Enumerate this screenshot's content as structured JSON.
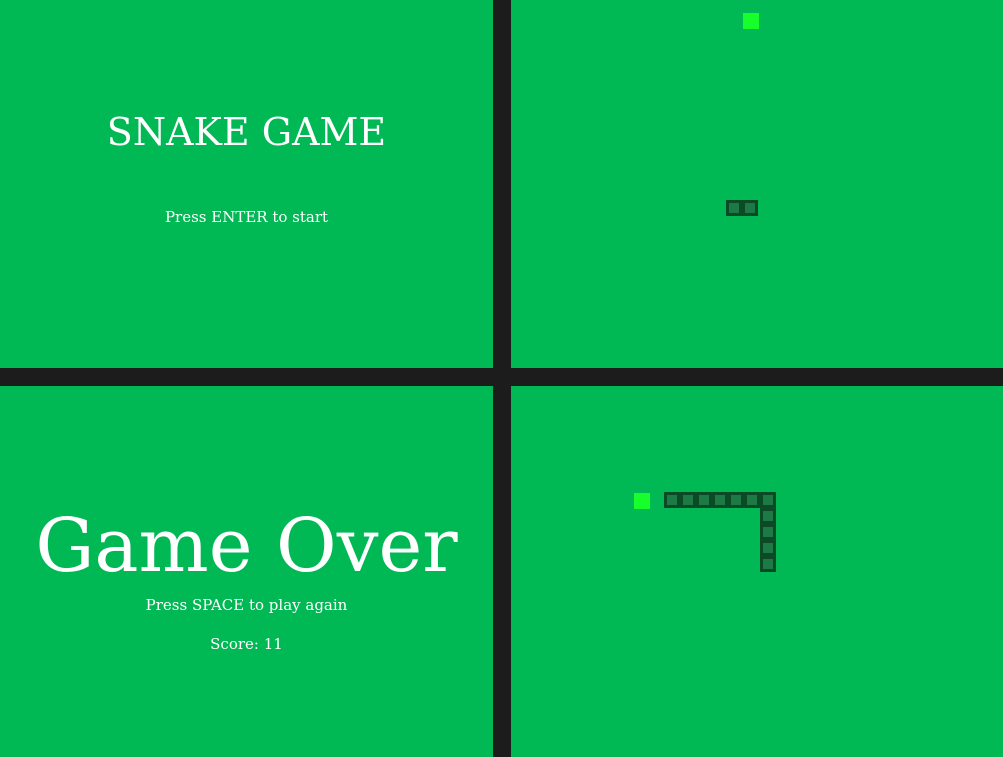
{
  "title_screen": {
    "title": "SNAKE GAME",
    "prompt": "Press ENTER to start"
  },
  "game_over_screen": {
    "title": "Game Over",
    "prompt": "Press SPACE to play again",
    "score_label": "Score: 11"
  },
  "colors": {
    "background": "#00b954",
    "divider": "#1c1c1c",
    "snake_fill": "#1e7a45",
    "snake_border": "#0a4a25",
    "food": "#16ff2a",
    "text": "#ffffff"
  },
  "gameplay_1": {
    "snake_length": 2,
    "food_count": 1
  },
  "gameplay_2": {
    "snake_length": 10,
    "food_count": 1
  }
}
